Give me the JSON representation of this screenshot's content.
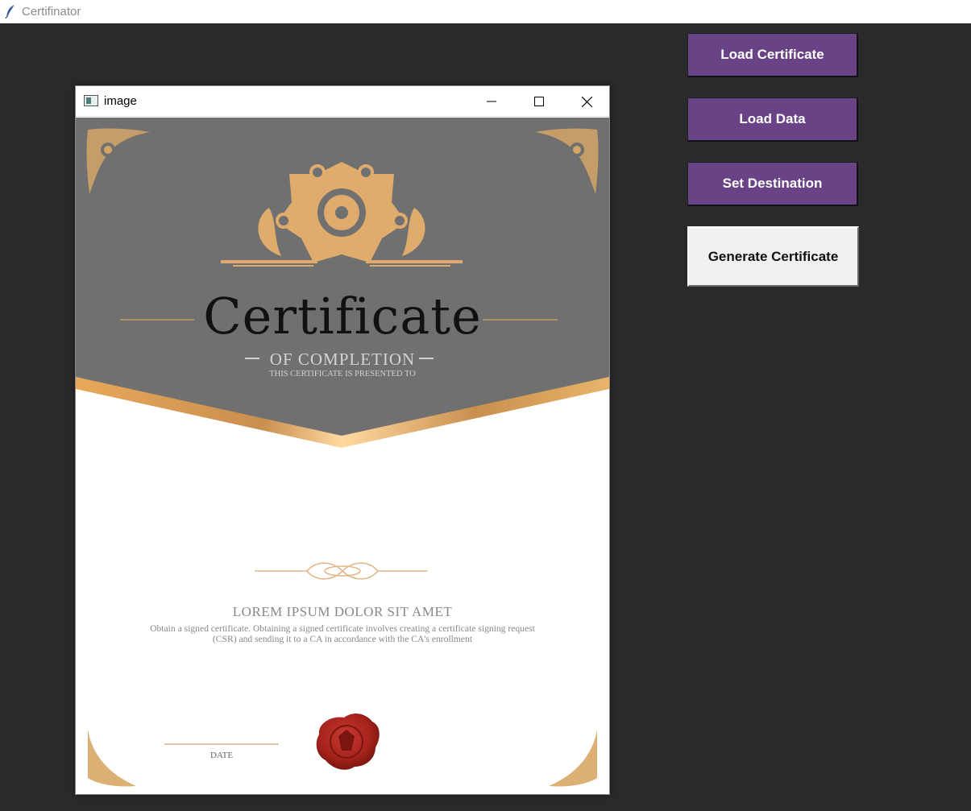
{
  "app": {
    "title": "Certifinator",
    "icon": "feather-icon"
  },
  "buttons": {
    "load_certificate": "Load Certificate",
    "load_data": "Load Data",
    "set_destination": "Set Destination",
    "generate_certificate": "Generate Certificate"
  },
  "image_window": {
    "title": "image",
    "controls": [
      "minimize-icon",
      "maximize-icon",
      "close-icon"
    ]
  },
  "certificate": {
    "title": "Certificate",
    "subtitle": "OF COMPLETION",
    "presented_to": "THIS CERTIFICATE IS PRESENTED TO",
    "heading": "LOREM IPSUM DOLOR SIT AMET",
    "body": "Obtain a signed certificate. Obtaining a signed certificate involves creating a certificate signing request (CSR) and sending it to a CA in accordance with the CA's enrollment",
    "date_label": "DATE",
    "seal": "wax-seal-icon"
  },
  "colors": {
    "background": "#2b2a2a",
    "button_purple": "#6a4387",
    "certificate_gray": "#707070",
    "gold": "#d9a866",
    "seal_red": "#b02a22"
  }
}
